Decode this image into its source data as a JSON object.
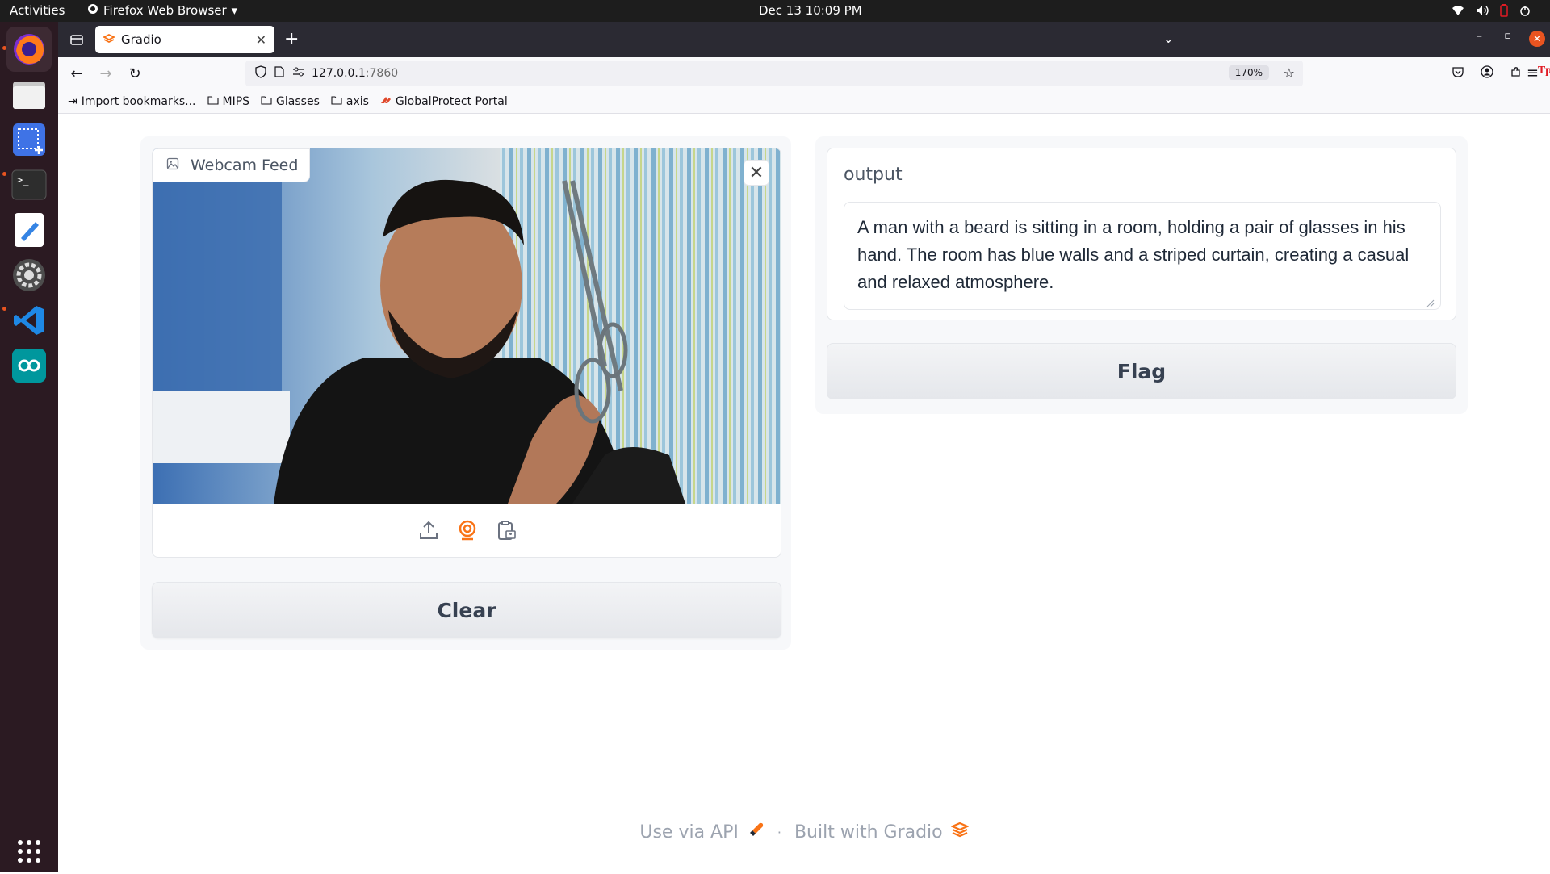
{
  "topbar": {
    "activities": "Activities",
    "app_name": "Firefox Web Browser",
    "clock": "Dec 13  10:09 PM"
  },
  "dock": {
    "items": [
      "firefox-icon",
      "files-icon",
      "screenshot-icon",
      "terminal-icon",
      "text-editor-icon",
      "settings-icon",
      "vscode-icon",
      "arduino-icon",
      "app-grid-icon"
    ]
  },
  "browser": {
    "tab_title": "Gradio",
    "url_host": "127.0.0.1",
    "url_port": ":7860",
    "zoom": "170%",
    "bookmarks": [
      "Import bookmarks...",
      "MIPS",
      "Glasses",
      "axis",
      "GlobalProtect Portal"
    ]
  },
  "app": {
    "image_label": "Webcam Feed",
    "clear_label": "Clear",
    "output_label": "output",
    "output_text": "A man with a beard is sitting in a room, holding a pair of glasses in his hand. The room has blue walls and a striped curtain, creating a casual and relaxed atmosphere.",
    "flag_label": "Flag",
    "footer_api": "Use via API",
    "footer_sep": "·",
    "footer_built": "Built with Gradio"
  },
  "colors": {
    "accent": "#f97316",
    "dock_bg": "#2b1a22",
    "ubuntu_orange": "#e95420"
  }
}
